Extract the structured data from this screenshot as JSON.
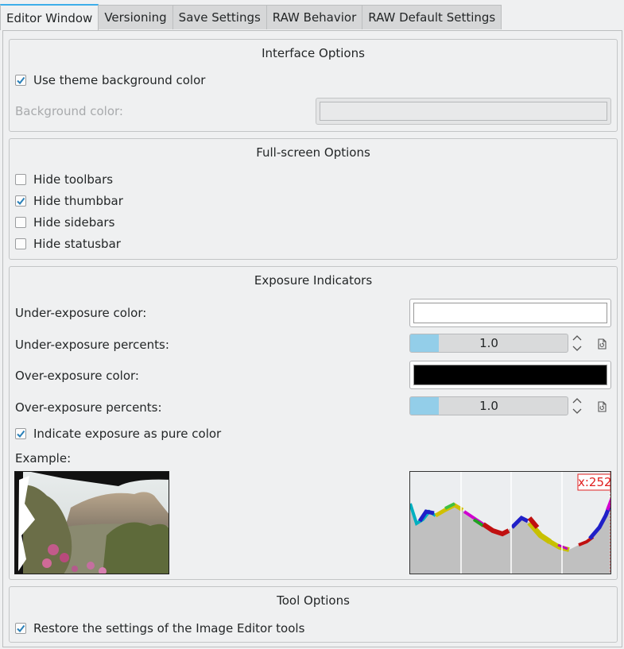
{
  "tabs": [
    "Editor Window",
    "Versioning",
    "Save Settings",
    "RAW Behavior",
    "RAW Default Settings"
  ],
  "interface": {
    "title": "Interface Options",
    "use_theme_bg": "Use theme background color",
    "use_theme_bg_checked": true,
    "bg_color_label": "Background color:"
  },
  "fullscreen": {
    "title": "Full-screen Options",
    "items": [
      {
        "label": "Hide toolbars",
        "checked": false
      },
      {
        "label": "Hide thumbbar",
        "checked": true
      },
      {
        "label": "Hide sidebars",
        "checked": false
      },
      {
        "label": "Hide statusbar",
        "checked": false
      }
    ]
  },
  "exposure": {
    "title": "Exposure Indicators",
    "under_color_label": "Under-exposure color:",
    "under_color": "#ffffff",
    "under_pct_label": "Under-exposure percents:",
    "under_pct_value": "1.0",
    "under_pct_fraction": 0.18,
    "over_color_label": "Over-exposure color:",
    "over_color": "#000000",
    "over_pct_label": "Over-exposure percents:",
    "over_pct_value": "1.0",
    "over_pct_fraction": 0.18,
    "pure_color_label": "Indicate exposure as pure color",
    "pure_color_checked": true,
    "example_label": "Example:",
    "histogram_marker": "x:252"
  },
  "tool": {
    "title": "Tool Options",
    "restore_label": "Restore the settings of the Image Editor tools",
    "restore_checked": true
  },
  "colors": {
    "accent": "#3daee9",
    "check": "#2980b9",
    "marker": "#e02020"
  }
}
